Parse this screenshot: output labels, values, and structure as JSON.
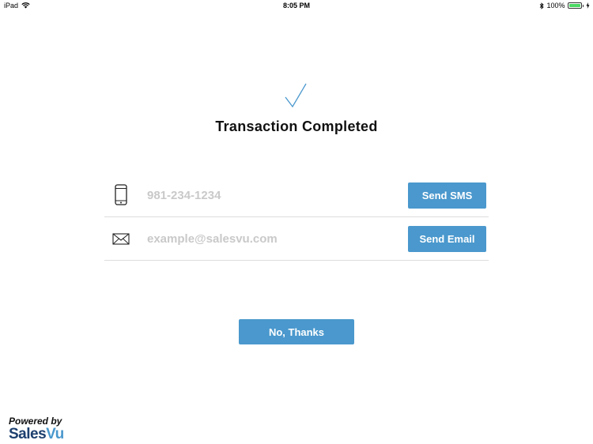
{
  "status_bar": {
    "device": "iPad",
    "time": "8:05 PM",
    "battery": "100%",
    "battery_level": 1.0,
    "icons": [
      "wifi-icon",
      "bluetooth-icon",
      "battery-icon",
      "charging-icon"
    ]
  },
  "main": {
    "title": "Transaction Completed",
    "check_icon": "checkmark-icon",
    "accent_color": "#4a98cd"
  },
  "sms": {
    "icon": "phone-icon",
    "placeholder": "981-234-1234",
    "value": "",
    "button_label": "Send SMS"
  },
  "email": {
    "icon": "envelope-icon",
    "placeholder": "example@salesvu.com",
    "value": "",
    "button_label": "Send Email"
  },
  "dismiss": {
    "label": "No, Thanks"
  },
  "footer": {
    "powered_by": "Powered by",
    "brand_part1": "Sales",
    "brand_part2": "Vu",
    "brand_color_dark": "#1c3f6e",
    "brand_color_light": "#4a98cd"
  }
}
